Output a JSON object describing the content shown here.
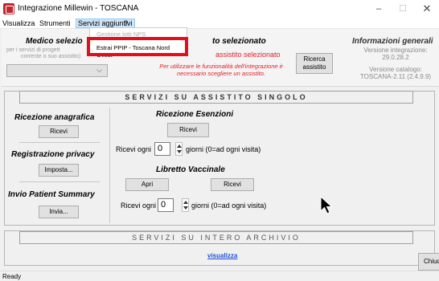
{
  "window": {
    "title": "Integrazione Millewin - TOSCANA",
    "minimize": "–",
    "maximize": "☐",
    "close": "✕",
    "brand_color": "#c0282d"
  },
  "menubar": {
    "items": [
      "Visualizza",
      "Strumenti",
      "Servizi aggiuntivi",
      "?"
    ]
  },
  "dropdown": {
    "items": [
      "Gestione lotti NPS",
      "Estrai PPIP - Toscana Nord Ovest"
    ],
    "highlight_color": "#e0101a"
  },
  "medico": {
    "title": "Medico selezio",
    "sub1": "per i servizi di progett",
    "sub2": "corrente o suo assistito)",
    "select_value": ""
  },
  "assistito": {
    "title": "to selezionato",
    "red_text": "assistito selezionato",
    "warn1": "Per utilizzare le funzionalità dell'integrazione è",
    "warn2": "necessario scegliere un assistito.",
    "ricerca_label": "Ricerca assistito",
    "alert_color": "#e0202a"
  },
  "info": {
    "title": "Informazioni generali",
    "line1": "Versione integrazione:",
    "line2": "29.0.28.2",
    "line3": "Versione catalogo:",
    "line4": "TOSCANA-2.11 (2.4.9.9)"
  },
  "singolo": {
    "header": "SERVIZI SU ASSISTITO SINGOLO",
    "anagrafica_title": "Ricezione anagrafica",
    "anagrafica_button": "Ricevi",
    "privacy_title": "Registrazione privacy",
    "privacy_button": "Imposta...",
    "patient_summary_title": "Invio Patient Summary",
    "patient_summary_button": "Invia...",
    "esenzioni_title": "Ricezione Esenzioni",
    "esenzioni_button": "Ricevi",
    "esenzioni_ricevi_ogni": "Ricevi ogni",
    "esenzioni_value": "0",
    "esenzioni_giorni": "giorni (0=ad ogni visita)",
    "libretto_title": "Libretto Vaccinale",
    "libretto_apri": "Apri",
    "libretto_ricevi": "Ricevi",
    "libretto_ricevi_ogni": "Ricevi ogni",
    "libretto_value": "0",
    "libretto_giorni": "giorni (0=ad ogni visita)"
  },
  "archivio": {
    "header": "SERVIZI SU INTERO ARCHIVIO",
    "link": "visualizza",
    "chiudi": "Chiudi"
  },
  "status": {
    "text": "Ready"
  }
}
